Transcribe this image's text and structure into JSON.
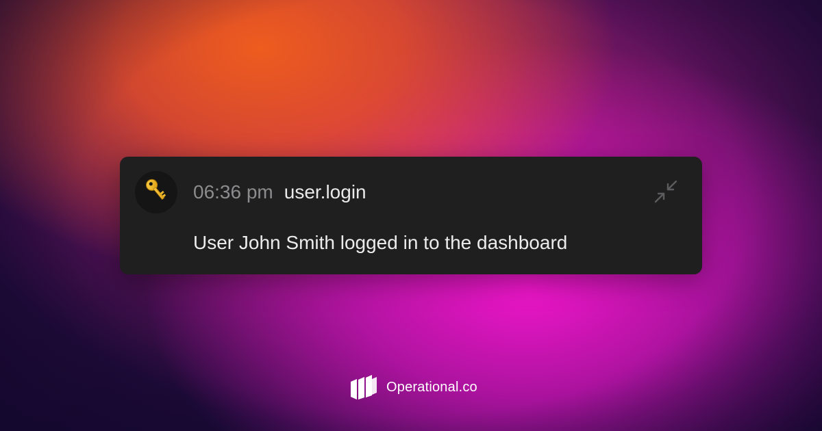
{
  "event_card": {
    "avatar_icon": "key-icon",
    "time": "06:36 pm",
    "event_name": "user.login",
    "message": "User John Smith logged in to the dashboard",
    "collapse_icon": "collapse-arrows-icon"
  },
  "brand": {
    "logo_icon": "operational-logo-icon",
    "name": "Operational.co"
  },
  "colors": {
    "card_background": "#1f1f20",
    "time_text": "#8c8c8e",
    "primary_text": "#ececed",
    "gradient_orange": "#ee5c1e",
    "gradient_magenta": "#ec16c8",
    "gradient_navy": "#160b30"
  }
}
